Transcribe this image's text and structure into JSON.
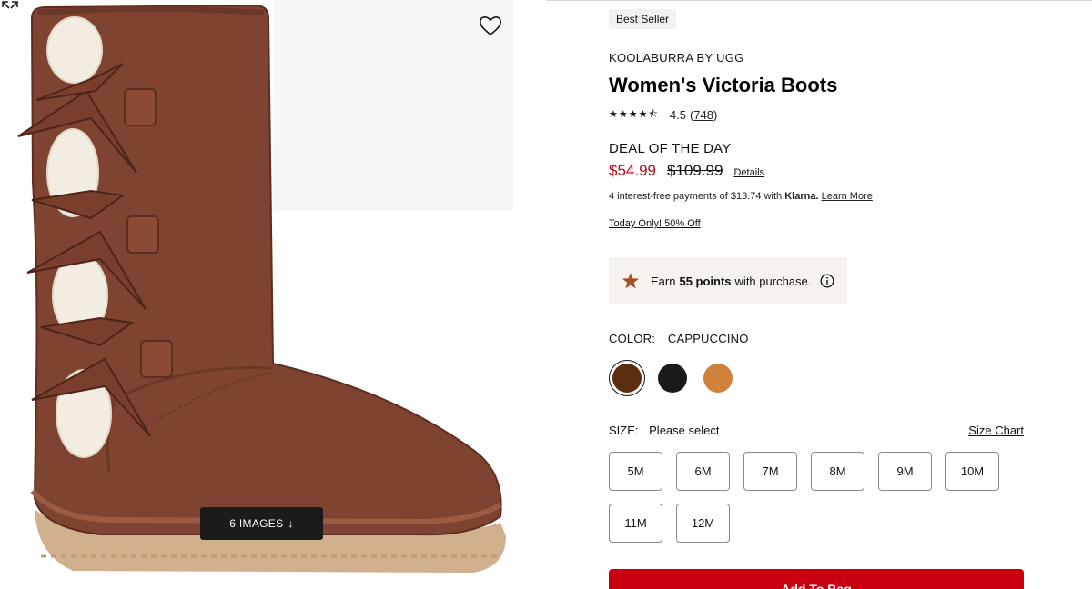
{
  "gallery": {
    "images_label": "6 IMAGES",
    "images_arrow": "↓"
  },
  "product": {
    "badge": "Best Seller",
    "brand": "KOOLABURRA BY UGG",
    "title": "Women's Victoria Boots",
    "rating": {
      "stars": 4.5,
      "value": "4.5",
      "count": "748"
    },
    "deal_label": "DEAL OF THE DAY",
    "sale_price": "$54.99",
    "original_price": "$109.99",
    "details_link": "Details",
    "klarna": {
      "prefix": "4 interest-free payments of $13.74 with",
      "brand": "Klarna.",
      "learn_more": "Learn More"
    },
    "promo": "Today Only! 50% Off",
    "points": {
      "prefix": "Earn",
      "amount": "55 points",
      "suffix": "with purchase."
    }
  },
  "color": {
    "label": "COLOR:",
    "value": "CAPPUCCINO",
    "swatches": [
      {
        "name": "Cappuccino",
        "hex": "#5a2e0e",
        "selected": true
      },
      {
        "name": "Black",
        "hex": "#1a1a1a",
        "selected": false
      },
      {
        "name": "Chestnut",
        "hex": "#d0813a",
        "selected": false
      }
    ]
  },
  "size": {
    "label": "SIZE:",
    "value": "Please select",
    "chart_link": "Size Chart",
    "options": [
      "5M",
      "6M",
      "7M",
      "8M",
      "9M",
      "10M",
      "11M",
      "12M"
    ]
  },
  "cta": {
    "add_to_bag": "Add To Bag"
  },
  "colors": {
    "sale_red": "#b10e1e",
    "cta_red": "#c8000f",
    "points_star": "#a0522d"
  }
}
